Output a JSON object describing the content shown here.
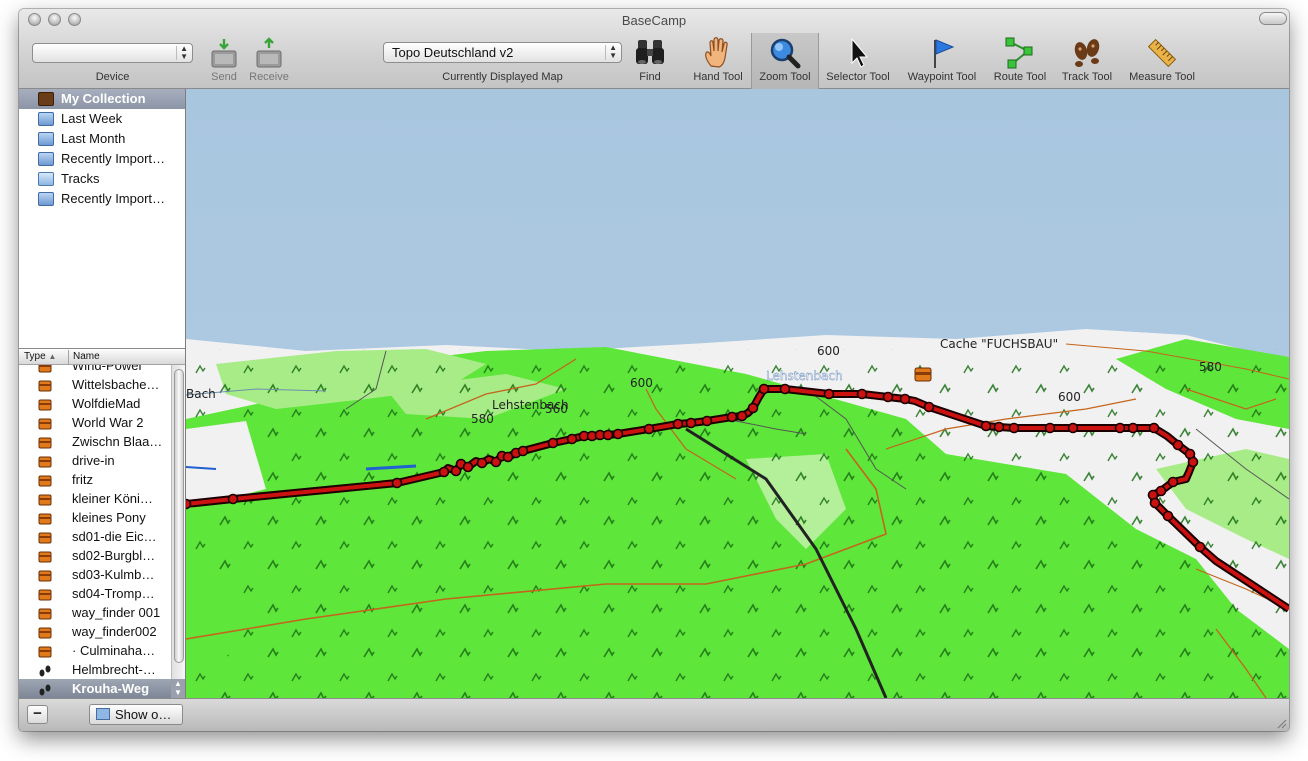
{
  "window": {
    "title": "BaseCamp"
  },
  "toolbar": {
    "device": {
      "label": "Device",
      "value": ""
    },
    "send_label": "Send",
    "receive_label": "Receive",
    "map_select": {
      "value": "Topo Deutschland v2",
      "label": "Currently Displayed Map"
    },
    "find_label": "Find",
    "tools": {
      "hand": "Hand Tool",
      "zoom": "Zoom Tool",
      "selector": "Selector Tool",
      "waypoint": "Waypoint Tool",
      "route": "Route Tool",
      "track": "Track Tool",
      "measure": "Measure Tool"
    },
    "active_tool": "Zoom Tool"
  },
  "collection": {
    "items": [
      {
        "label": "My Collection",
        "icon": "collection-box-icon",
        "selected": true
      },
      {
        "label": "Last Week",
        "icon": "smart-list-icon"
      },
      {
        "label": "Last Month",
        "icon": "smart-list-icon"
      },
      {
        "label": "Recently Import…",
        "icon": "smart-list-icon"
      },
      {
        "label": "Tracks",
        "icon": "folder-icon"
      },
      {
        "label": "Recently Import…",
        "icon": "smart-list-icon"
      }
    ]
  },
  "list": {
    "columns": {
      "type": "Type",
      "name": "Name"
    },
    "rows": [
      {
        "type": "geocache",
        "name": "Wind-Power"
      },
      {
        "type": "geocache",
        "name": "Wittelsbache…"
      },
      {
        "type": "geocache",
        "name": "WolfdieMad"
      },
      {
        "type": "geocache",
        "name": "World War 2"
      },
      {
        "type": "geocache",
        "name": "Zwischn Blaa…"
      },
      {
        "type": "geocache",
        "name": "drive-in"
      },
      {
        "type": "geocache",
        "name": "fritz"
      },
      {
        "type": "geocache",
        "name": "kleiner Köni…"
      },
      {
        "type": "geocache",
        "name": "kleines Pony"
      },
      {
        "type": "geocache",
        "name": "sd01-die Eic…"
      },
      {
        "type": "geocache",
        "name": "sd02-Burgbl…"
      },
      {
        "type": "geocache",
        "name": "sd03-Kulmb…"
      },
      {
        "type": "geocache",
        "name": "sd04-Tromp…"
      },
      {
        "type": "geocache",
        "name": "way_finder 001"
      },
      {
        "type": "geocache",
        "name": "way_finder002"
      },
      {
        "type": "geocache",
        "name": "· Culminaha…"
      },
      {
        "type": "track",
        "name": "Helmbrecht-…"
      },
      {
        "type": "track",
        "name": "Krouha-Weg",
        "selected": true
      }
    ]
  },
  "map": {
    "labels": {
      "bach": "Bach",
      "lehstenbach_1": "Lehstenbach",
      "lehstenbach_2": "Lehstenbach",
      "cache": "Cache \"FUCHSBAU\"",
      "e580_a": "580",
      "e560": "560",
      "e600_a": "600",
      "e600_b": "600",
      "e600_c": "600",
      "e580_b": "580"
    },
    "colors": {
      "sky": "#a9c6df",
      "forest": "#5ee63a",
      "light_forest": "#a8ec88",
      "open_land": "#f1f1f1",
      "track": "#cc1111"
    }
  },
  "bottom": {
    "minus_label": "−",
    "show_label": "Show o…"
  }
}
